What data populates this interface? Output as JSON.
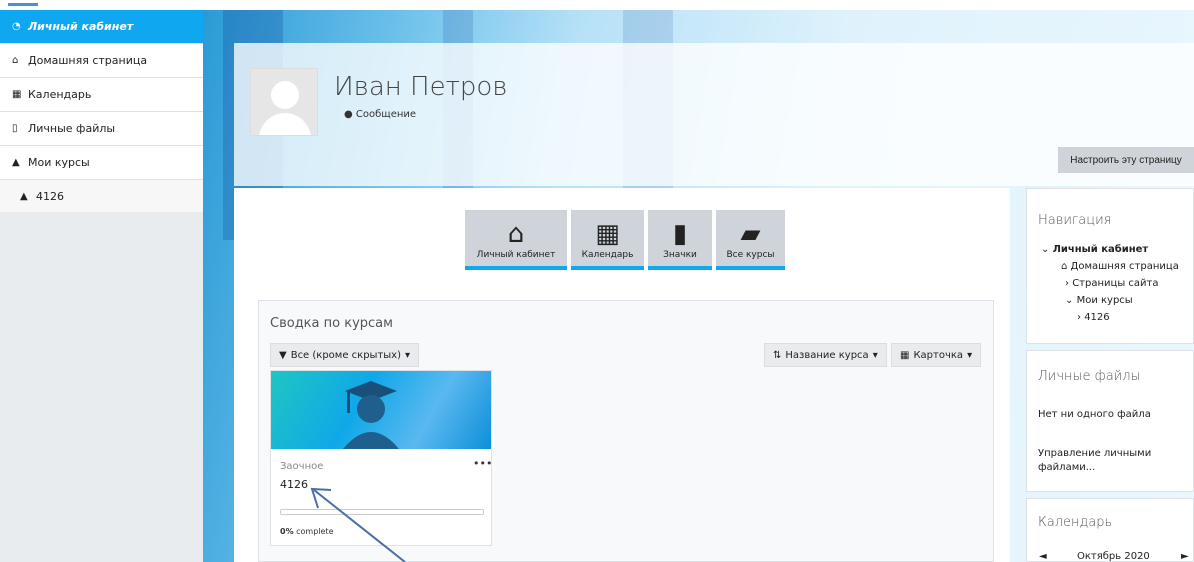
{
  "sidebar": {
    "items": [
      {
        "label": "Личный кабинет",
        "icon": "dashboard-icon"
      },
      {
        "label": "Домашняя страница",
        "icon": "home-icon"
      },
      {
        "label": "Календарь",
        "icon": "calendar-icon"
      },
      {
        "label": "Личные файлы",
        "icon": "file-icon"
      },
      {
        "label": "Мои курсы",
        "icon": "graduation-cap-icon"
      }
    ],
    "course": "4126"
  },
  "header": {
    "user_name": "Иван Петров",
    "message_label": "Сообщение",
    "customize_button": "Настроить эту страницу"
  },
  "tiles": [
    {
      "label": "Личный кабинет",
      "icon": "home-icon"
    },
    {
      "label": "Календарь",
      "icon": "calendar-icon"
    },
    {
      "label": "Значки",
      "icon": "bookmark-icon"
    },
    {
      "label": "Все курсы",
      "icon": "book-icon"
    }
  ],
  "course_overview": {
    "title": "Сводка по курсам",
    "filter": "Все (кроме скрытых)",
    "sort": "Название курса",
    "view": "Карточка",
    "course": {
      "category": "Заочное",
      "name": "4126",
      "progress_percent": 0,
      "progress_value": "0%",
      "progress_suffix": " complete"
    }
  },
  "navigation": {
    "title": "Навигация",
    "root": "Личный кабинет",
    "home": "Домашняя страница",
    "site_pages": "Страницы сайта",
    "my_courses": "Мои курсы",
    "course": "4126"
  },
  "private_files": {
    "title": "Личные файлы",
    "empty": "Нет ни одного файла",
    "manage_link": "Управление личными файлами..."
  },
  "calendar": {
    "title": "Календарь",
    "prev": "◄",
    "month": "Октябрь 2020",
    "next": "►"
  },
  "colors": {
    "accent": "#0fa8f0",
    "tile_bg": "#ced4da",
    "arrow": "#4a6fa5"
  }
}
